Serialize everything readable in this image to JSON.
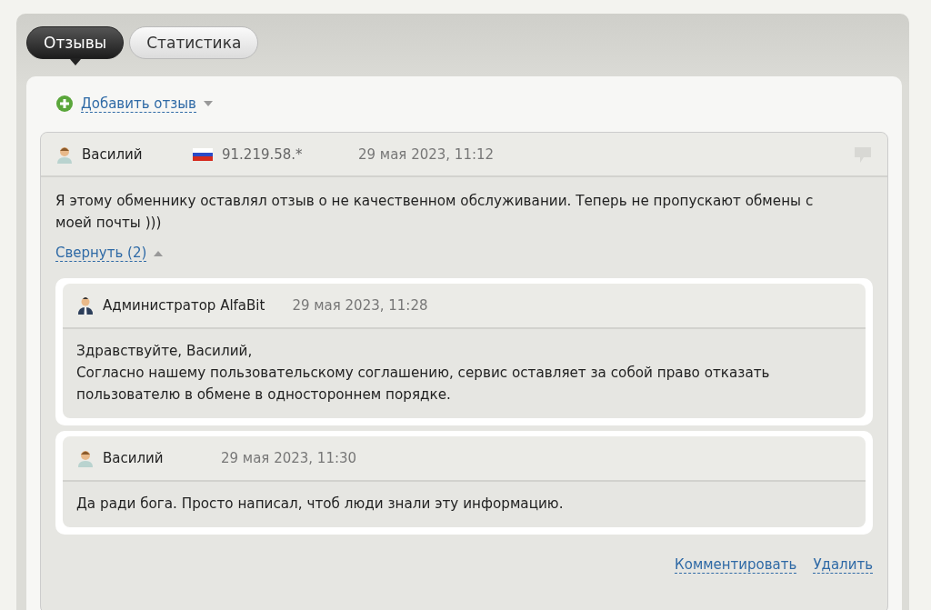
{
  "tabs": [
    {
      "label": "Отзывы",
      "selected": true
    },
    {
      "label": "Статистика",
      "selected": false
    }
  ],
  "add_review": {
    "label": "Добавить отзыв"
  },
  "review": {
    "author": "Василий",
    "kind": "user",
    "ip": "91.219.58.*",
    "date": "29 мая 2023, 11:12",
    "text": "Я этому обменнику оставлял отзыв о не качественном обслуживании. Теперь не пропускают обмены с моей почты )))",
    "collapse_link": "Свернуть (2)",
    "replies": [
      {
        "author": "Администратор AlfaBit",
        "kind": "admin",
        "date": "29 мая 2023, 11:28",
        "lines": [
          "Здравствуйте, Василий,",
          "Согласно нашему пользовательскому соглашению, сервис оставляет за собой право отказать пользователю в обмене в одностороннем порядке."
        ]
      },
      {
        "author": "Василий",
        "kind": "user",
        "date": "29 мая 2023, 11:30",
        "lines": [
          "Да ради бога. Просто написал, чтоб люди знали эту информацию."
        ]
      }
    ],
    "actions": [
      "Комментировать",
      "Удалить"
    ]
  }
}
